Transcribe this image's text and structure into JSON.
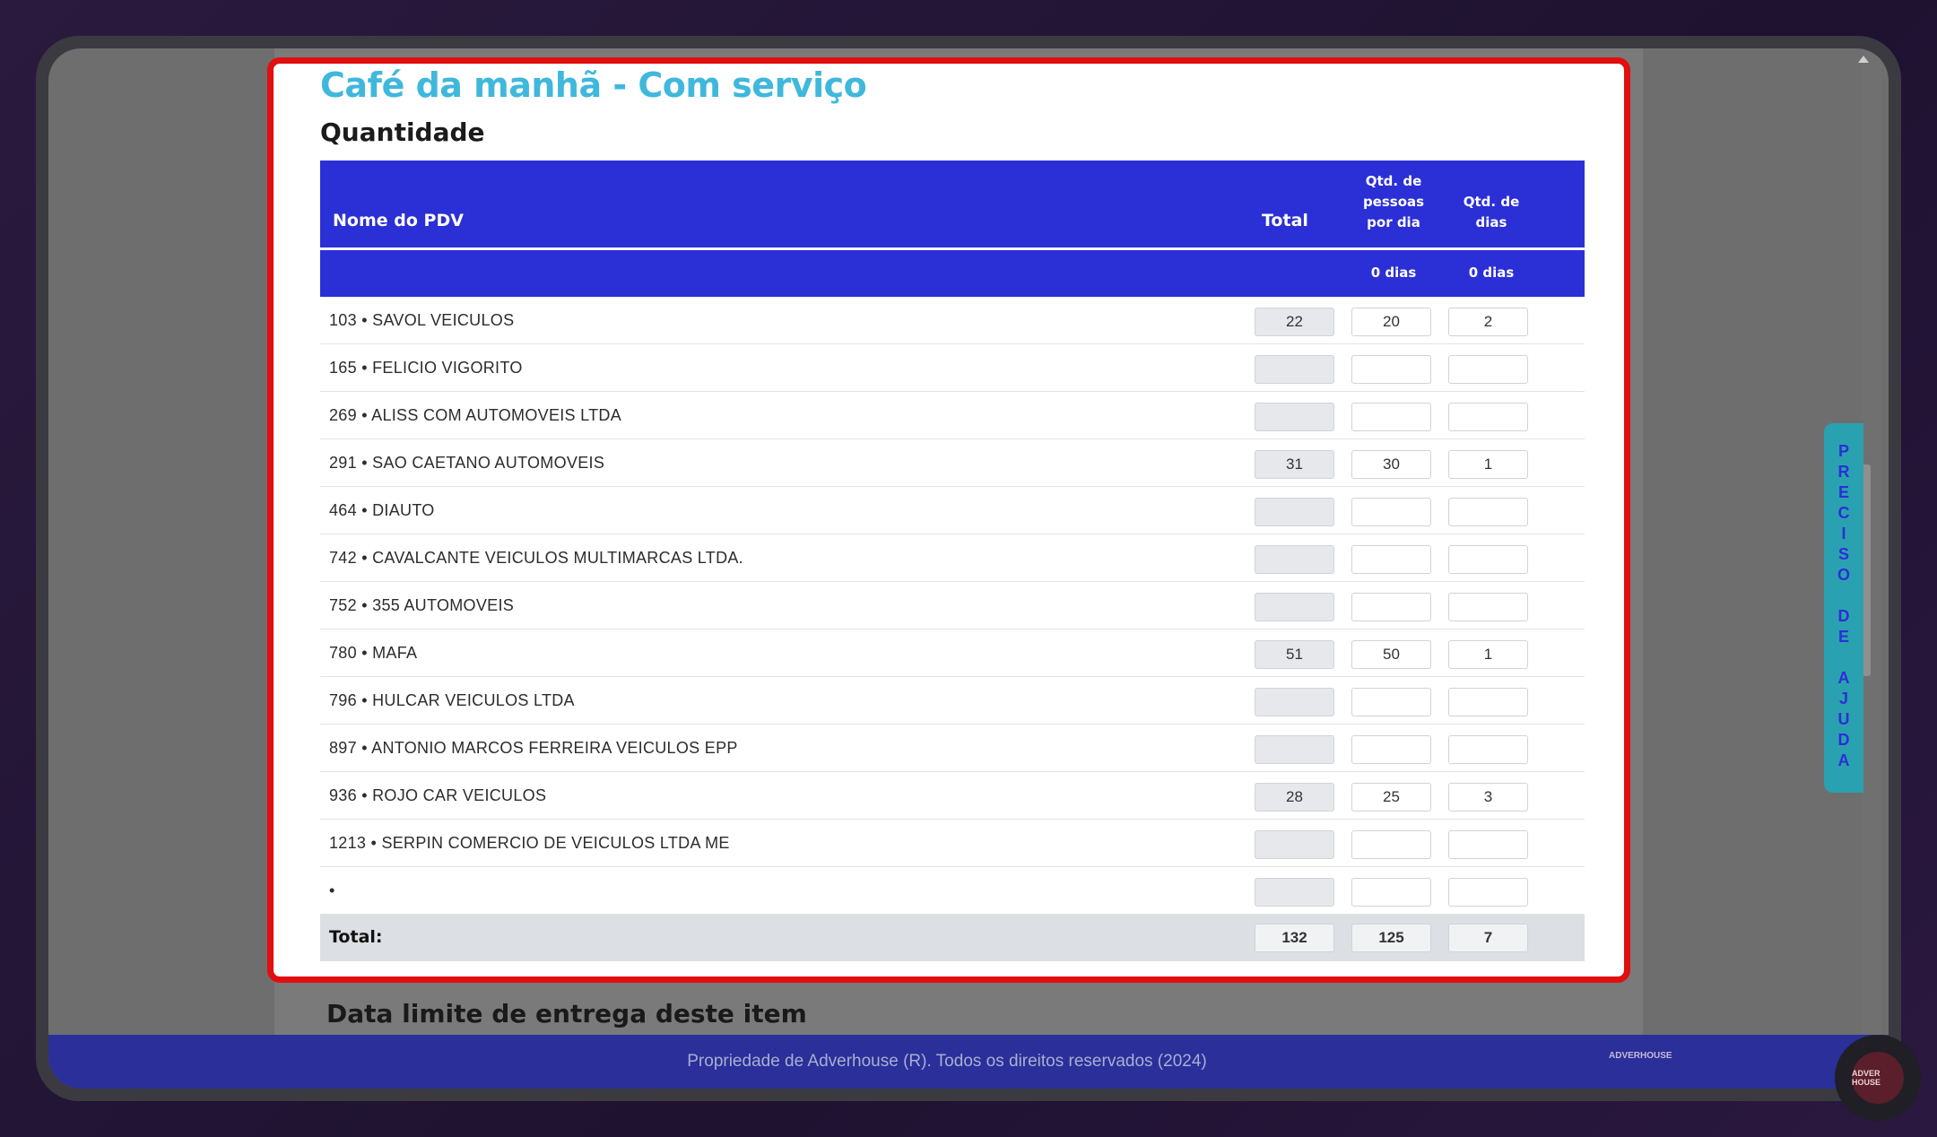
{
  "panel": {
    "title": "Café da manhã - Com serviço",
    "subtitle": "Quantidade"
  },
  "table": {
    "headers": {
      "name": "Nome do PDV",
      "total": "Total",
      "people_line1": "Qtd. de",
      "people_line2": "pessoas",
      "people_line3": "por dia",
      "days_line1": "Qtd. de",
      "days_line2": "dias"
    },
    "subheader": {
      "people": "0 dias",
      "days": "0 dias"
    },
    "rows": [
      {
        "name": "103 • SAVOL VEICULOS",
        "total": "22",
        "people": "20",
        "days": "2"
      },
      {
        "name": "165 • FELICIO VIGORITO",
        "total": "",
        "people": "",
        "days": ""
      },
      {
        "name": "269 • ALISS COM AUTOMOVEIS LTDA",
        "total": "",
        "people": "",
        "days": ""
      },
      {
        "name": "291 • SAO CAETANO AUTOMOVEIS",
        "total": "31",
        "people": "30",
        "days": "1"
      },
      {
        "name": "464 • DIAUTO",
        "total": "",
        "people": "",
        "days": ""
      },
      {
        "name": "742 • CAVALCANTE VEICULOS MULTIMARCAS LTDA.",
        "total": "",
        "people": "",
        "days": ""
      },
      {
        "name": "752 • 355 AUTOMOVEIS",
        "total": "",
        "people": "",
        "days": ""
      },
      {
        "name": "780 • MAFA",
        "total": "51",
        "people": "50",
        "days": "1"
      },
      {
        "name": "796 • HULCAR VEICULOS LTDA",
        "total": "",
        "people": "",
        "days": ""
      },
      {
        "name": "897 • ANTONIO MARCOS FERREIRA VEICULOS EPP",
        "total": "",
        "people": "",
        "days": ""
      },
      {
        "name": "936 • ROJO CAR VEICULOS",
        "total": "28",
        "people": "25",
        "days": "3"
      },
      {
        "name": "1213 • SERPIN COMERCIO DE VEICULOS LTDA ME",
        "total": "",
        "people": "",
        "days": ""
      },
      {
        "name": "•",
        "total": "",
        "people": "",
        "days": ""
      }
    ],
    "totals": {
      "label": "Total:",
      "total": "132",
      "people": "125",
      "days": "7"
    }
  },
  "next_section_title": "Data limite de entrega deste item",
  "footer": {
    "text": "Propriedade de Adverhouse (R). Todos os direitos reservados (2024)",
    "logo_text": "ADVERHOUSE"
  },
  "help_tab": {
    "word1": "PRECISO",
    "word2": "DE",
    "word3": "AJUDA"
  },
  "chat_widget": {
    "label": "ADVER HOUSE"
  },
  "colors": {
    "accent_title": "#3fb8dc",
    "table_header": "#2b2fd6",
    "panel_border": "#e10f0f",
    "footer": "#2b2f9a",
    "help_tab": "#2aa1b0"
  }
}
